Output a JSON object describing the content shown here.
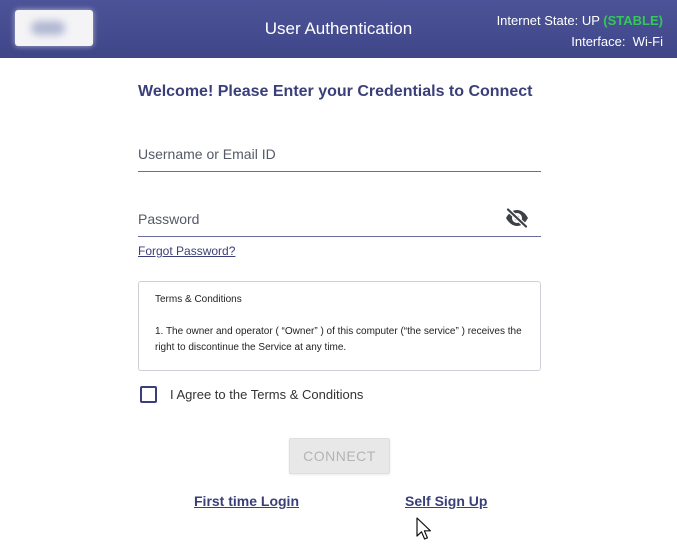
{
  "header": {
    "title": "User Authentication",
    "internet_state_label": "Internet State: UP",
    "internet_state_status": "(STABLE)",
    "interface_label": "Interface:",
    "interface_value": "Wi-Fi"
  },
  "form": {
    "welcome": "Welcome! Please Enter your Credentials to Connect",
    "username_placeholder": "Username or Email ID",
    "password_placeholder": "Password",
    "forgot_password": "Forgot Password?",
    "password_toggle_icon": "eye-slash-icon"
  },
  "terms": {
    "title": "Terms & Conditions",
    "text": "1. The owner and operator ( “Owner” ) of this computer (“the service” ) receives the right to discontinue the Service at any time.",
    "agree_label": "I Agree to the Terms & Conditions",
    "agreed": false
  },
  "actions": {
    "connect_label": "CONNECT",
    "first_time_login": "First time Login",
    "self_sign_up": "Self Sign Up"
  },
  "colors": {
    "header_bg": "#444b8e",
    "accent": "#3a3f7a",
    "stable": "#34c759",
    "button_disabled_bg": "#e8e8e8",
    "button_disabled_text": "#b4b4b4"
  }
}
